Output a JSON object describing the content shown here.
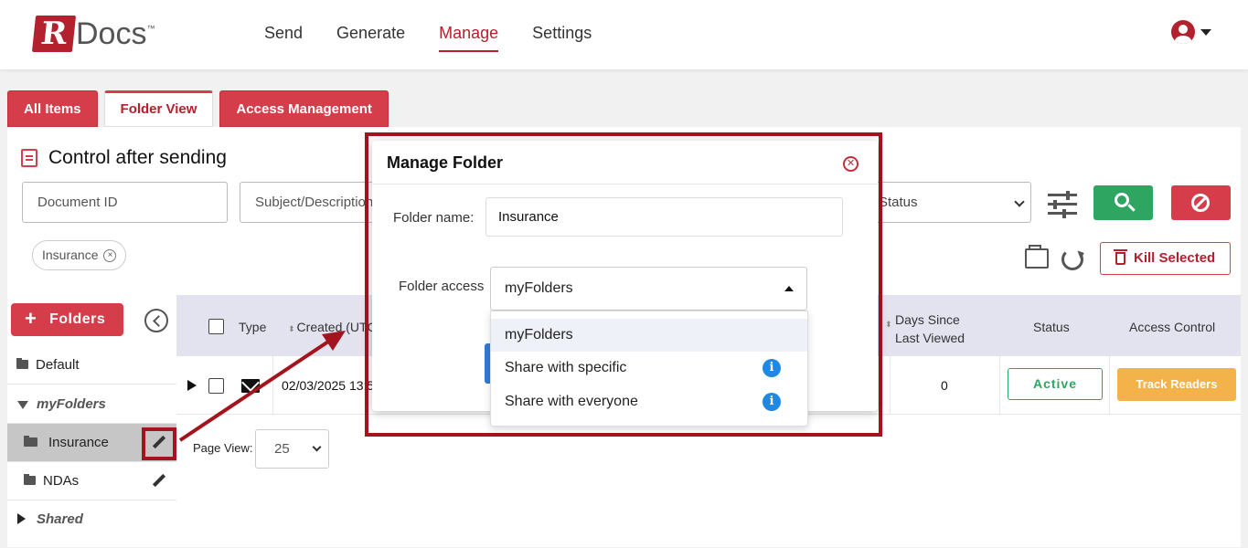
{
  "app": {
    "logo_letter": "R",
    "logo_text": "Docs",
    "logo_tm": "™"
  },
  "nav": {
    "items": [
      {
        "label": "Send"
      },
      {
        "label": "Generate"
      },
      {
        "label": "Manage"
      },
      {
        "label": "Settings"
      }
    ],
    "active": "Manage"
  },
  "tabs": [
    {
      "label": "All Items"
    },
    {
      "label": "Folder View"
    },
    {
      "label": "Access Management"
    }
  ],
  "page": {
    "title": "Control after sending"
  },
  "filters": {
    "document_id_placeholder": "Document ID",
    "subject_placeholder": "Subject/Description",
    "status_placeholder": "Status",
    "chip_label": "Insurance",
    "kill_label": "Kill Selected"
  },
  "sidebar": {
    "folders_button": "Folders",
    "items": [
      {
        "label": "Default"
      },
      {
        "label": "myFolders"
      },
      {
        "label": "Insurance"
      },
      {
        "label": "NDAs"
      },
      {
        "label": "Shared"
      }
    ]
  },
  "table": {
    "headers": {
      "type": "Type",
      "created": "Created (UTC",
      "days_since_line1": "Days Since",
      "days_since_line2": "Last Viewed",
      "status": "Status",
      "access_control": "Access Control"
    },
    "rows": [
      {
        "created": "02/03/2025 13:5",
        "days_since": "0",
        "status": "Active",
        "access": "Track Readers"
      }
    ],
    "page_view_label": "Page View:",
    "page_view_value": "25"
  },
  "modal": {
    "title": "Manage Folder",
    "folder_name_label": "Folder name:",
    "folder_name_value": "Insurance",
    "folder_access_label": "Folder access",
    "folder_access_value": "myFolders",
    "options": [
      {
        "label": "myFolders"
      },
      {
        "label": "Share with specific"
      },
      {
        "label": "Share with everyone"
      }
    ]
  },
  "colors": {
    "brand": "#b3202e",
    "annotation": "#a3141e",
    "success": "#2fa562",
    "warning": "#f4b34a",
    "info": "#1e88e5"
  }
}
